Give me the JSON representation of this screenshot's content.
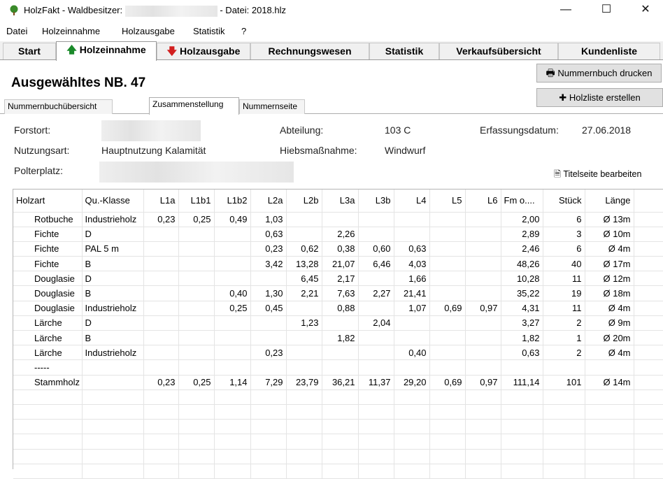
{
  "window": {
    "title_prefix": "HolzFakt - Waldbesitzer:",
    "title_suffix": "- Datei: 2018.hlz",
    "minimize": "—",
    "maximize": "☐",
    "close": "✕"
  },
  "menu": [
    "Datei",
    "Holzeinnahme",
    "Holzausgabe",
    "Statistik",
    "?"
  ],
  "main_tabs": [
    "Start",
    "Holzeinnahme",
    "Holzausgabe",
    "Rechnungswesen",
    "Statistik",
    "Verkaufsübersicht",
    "Kundenliste"
  ],
  "heading": "Ausgewähltes NB. 47",
  "buttons": {
    "print": "Nummernbuch drucken",
    "create": "Holzliste erstellen",
    "edit_title": "Titelseite bearbeiten"
  },
  "sub_tabs": [
    "Nummernbuchübersicht",
    "Zusammenstellung",
    "Nummernseite"
  ],
  "info": {
    "forstort_label": "Forstort:",
    "nutzungsart_label": "Nutzungsart:",
    "nutzungsart_value": "Hauptnutzung Kalamität",
    "polterplatz_label": "Polterplatz:",
    "abteilung_label": "Abteilung:",
    "abteilung_value": "103 C",
    "hiebsmassnahme_label": "Hiebsmaßnahme:",
    "hiebsmassnahme_value": "Windwurf",
    "erfassungsdatum_label": "Erfassungsdatum:",
    "erfassungsdatum_value": "27.06.2018"
  },
  "table": {
    "columns": [
      "Holzart",
      "Qu.-Klasse",
      "L1a",
      "L1b1",
      "L1b2",
      "L2a",
      "L2b",
      "L3a",
      "L3b",
      "L4",
      "L5",
      "L6",
      "Fm o....",
      "Stück",
      "Länge"
    ],
    "rows": [
      [
        "Rotbuche",
        "Industrieholz",
        "0,23",
        "0,25",
        "0,49",
        "1,03",
        "",
        "",
        "",
        "",
        "",
        "",
        "2,00",
        "6",
        "Ø 13m"
      ],
      [
        "Fichte",
        "D",
        "",
        "",
        "",
        "0,63",
        "",
        "2,26",
        "",
        "",
        "",
        "",
        "2,89",
        "3",
        "Ø 10m"
      ],
      [
        "Fichte",
        "PAL 5 m",
        "",
        "",
        "",
        "0,23",
        "0,62",
        "0,38",
        "0,60",
        "0,63",
        "",
        "",
        "2,46",
        "6",
        "Ø 4m"
      ],
      [
        "Fichte",
        "B",
        "",
        "",
        "",
        "3,42",
        "13,28",
        "21,07",
        "6,46",
        "4,03",
        "",
        "",
        "48,26",
        "40",
        "Ø 17m"
      ],
      [
        "Douglasie",
        "D",
        "",
        "",
        "",
        "",
        "6,45",
        "2,17",
        "",
        "1,66",
        "",
        "",
        "10,28",
        "11",
        "Ø 12m"
      ],
      [
        "Douglasie",
        "B",
        "",
        "",
        "0,40",
        "1,30",
        "2,21",
        "7,63",
        "2,27",
        "21,41",
        "",
        "",
        "35,22",
        "19",
        "Ø 18m"
      ],
      [
        "Douglasie",
        "Industrieholz",
        "",
        "",
        "0,25",
        "0,45",
        "",
        "0,88",
        "",
        "1,07",
        "0,69",
        "0,97",
        "4,31",
        "11",
        "Ø 4m"
      ],
      [
        "Lärche",
        "D",
        "",
        "",
        "",
        "",
        "1,23",
        "",
        "2,04",
        "",
        "",
        "",
        "3,27",
        "2",
        "Ø 9m"
      ],
      [
        "Lärche",
        "B",
        "",
        "",
        "",
        "",
        "",
        "1,82",
        "",
        "",
        "",
        "",
        "1,82",
        "1",
        "Ø 20m"
      ],
      [
        "Lärche",
        "Industrieholz",
        "",
        "",
        "",
        "0,23",
        "",
        "",
        "",
        "0,40",
        "",
        "",
        "0,63",
        "2",
        "Ø 4m"
      ],
      [
        "-----",
        "",
        "",
        "",
        "",
        "",
        "",
        "",
        "",
        "",
        "",
        "",
        "",
        "",
        ""
      ],
      [
        "Stammholz",
        "",
        "0,23",
        "0,25",
        "1,14",
        "7,29",
        "23,79",
        "36,21",
        "11,37",
        "29,20",
        "0,69",
        "0,97",
        "111,14",
        "101",
        "Ø 14m"
      ]
    ]
  }
}
